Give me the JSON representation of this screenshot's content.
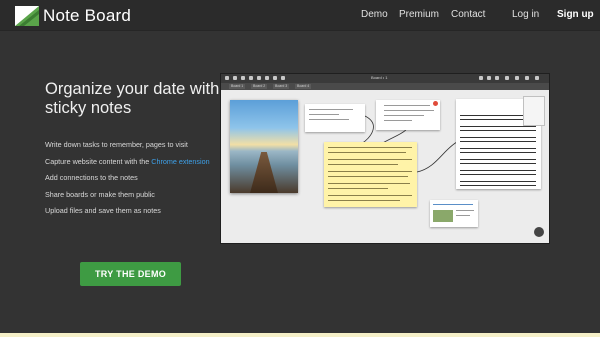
{
  "header": {
    "logo_text": "Note Board",
    "nav": {
      "demo": "Demo",
      "premium": "Premium",
      "contact": "Contact",
      "login": "Log in",
      "signup": "Sign up"
    }
  },
  "hero": {
    "headline": "Organize your date with sticky notes",
    "features": [
      "Write down tasks to remember, pages to visit",
      "Capture website content with the",
      "Add connections to the notes",
      "Share boards or make them public",
      "Upload files and save them as notes"
    ],
    "chrome_link_text": "Chrome extension",
    "cta_label": "TRY THE DEMO"
  },
  "colors": {
    "background": "#333333",
    "cta": "#3e9b43",
    "link": "#3ea0e8",
    "logo_green": "#5aa44a"
  },
  "preview": {
    "board_title": "Board • 1",
    "tabs": [
      "Board 1",
      "Board 2",
      "Board 3",
      "Board 4"
    ]
  }
}
